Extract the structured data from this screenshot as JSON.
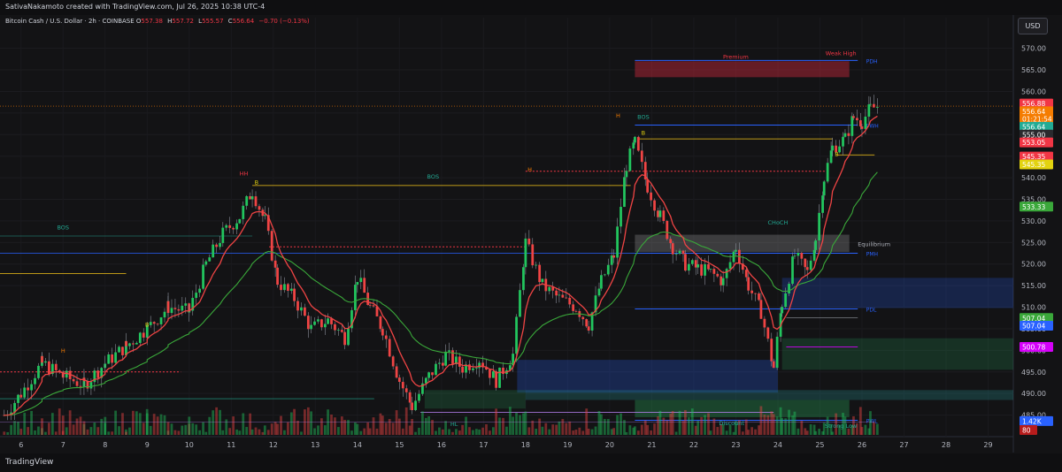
{
  "header": {
    "credit": "SativaNakamoto created with TradingView.com, Jul 26, 2025 10:38 UTC-4",
    "symbol": "Bitcoin Cash / U.S. Dollar · 2h · COINBASE",
    "open_label": "O",
    "open": "557.38",
    "high_label": "H",
    "high": "557.72",
    "low_label": "L",
    "low": "555.57",
    "close_label": "C",
    "close": "556.64",
    "change": "−0.70 (−0.13%)",
    "currency": "USD"
  },
  "footer": {
    "logo": "TradingView"
  },
  "colors": {
    "up": "#22c55e",
    "down": "#ef4444",
    "bg": "#131315",
    "ema_fast": "#ef4444",
    "ema_slow": "#3aa83a"
  },
  "chart_data": {
    "type": "candlestick",
    "ylim": [
      480,
      573
    ],
    "y_ticks": [
      "570.00",
      "565.00",
      "560.00",
      "555.00",
      "550.00",
      "545.00",
      "540.00",
      "535.00",
      "530.00",
      "525.00",
      "520.00",
      "515.00",
      "510.00",
      "505.00",
      "500.00",
      "495.00",
      "490.00",
      "485.00"
    ],
    "x_ticks": [
      "6",
      "7",
      "8",
      "9",
      "10",
      "11",
      "12",
      "13",
      "14",
      "15",
      "16",
      "17",
      "18",
      "19",
      "20",
      "21",
      "22",
      "23",
      "24",
      "25",
      "26",
      "27",
      "28",
      "29"
    ],
    "x_dom": [
      5.5,
      29.6
    ],
    "last_date": 26.4,
    "closes": [
      {
        "x": 5.6,
        "c": 485
      },
      {
        "x": 6.0,
        "c": 490
      },
      {
        "x": 6.5,
        "c": 497
      },
      {
        "x": 7.0,
        "c": 494
      },
      {
        "x": 7.5,
        "c": 492
      },
      {
        "x": 8.0,
        "c": 497
      },
      {
        "x": 8.5,
        "c": 501
      },
      {
        "x": 9.0,
        "c": 505
      },
      {
        "x": 9.5,
        "c": 510
      },
      {
        "x": 10.0,
        "c": 509
      },
      {
        "x": 10.4,
        "c": 520
      },
      {
        "x": 10.8,
        "c": 527
      },
      {
        "x": 11.2,
        "c": 531
      },
      {
        "x": 11.5,
        "c": 537
      },
      {
        "x": 11.8,
        "c": 530
      },
      {
        "x": 12.1,
        "c": 516
      },
      {
        "x": 12.5,
        "c": 512
      },
      {
        "x": 12.9,
        "c": 505
      },
      {
        "x": 13.3,
        "c": 507
      },
      {
        "x": 13.7,
        "c": 503
      },
      {
        "x": 14.0,
        "c": 517
      },
      {
        "x": 14.3,
        "c": 510
      },
      {
        "x": 14.6,
        "c": 505
      },
      {
        "x": 15.0,
        "c": 493
      },
      {
        "x": 15.3,
        "c": 487
      },
      {
        "x": 15.7,
        "c": 494
      },
      {
        "x": 16.1,
        "c": 499
      },
      {
        "x": 16.5,
        "c": 496
      },
      {
        "x": 16.9,
        "c": 498
      },
      {
        "x": 17.3,
        "c": 493
      },
      {
        "x": 17.7,
        "c": 499
      },
      {
        "x": 18.0,
        "c": 525
      },
      {
        "x": 18.4,
        "c": 515
      },
      {
        "x": 18.8,
        "c": 512
      },
      {
        "x": 19.2,
        "c": 510
      },
      {
        "x": 19.5,
        "c": 506
      },
      {
        "x": 19.8,
        "c": 516
      },
      {
        "x": 20.1,
        "c": 522
      },
      {
        "x": 20.4,
        "c": 543
      },
      {
        "x": 20.6,
        "c": 548
      },
      {
        "x": 20.9,
        "c": 538
      },
      {
        "x": 21.2,
        "c": 531
      },
      {
        "x": 21.5,
        "c": 524
      },
      {
        "x": 21.8,
        "c": 520
      },
      {
        "x": 22.1,
        "c": 519
      },
      {
        "x": 22.4,
        "c": 518
      },
      {
        "x": 22.7,
        "c": 516
      },
      {
        "x": 23.0,
        "c": 524
      },
      {
        "x": 23.3,
        "c": 515
      },
      {
        "x": 23.6,
        "c": 509
      },
      {
        "x": 23.9,
        "c": 496
      },
      {
        "x": 24.1,
        "c": 511
      },
      {
        "x": 24.4,
        "c": 522
      },
      {
        "x": 24.7,
        "c": 518
      },
      {
        "x": 24.9,
        "c": 526
      },
      {
        "x": 25.1,
        "c": 540
      },
      {
        "x": 25.3,
        "c": 547
      },
      {
        "x": 25.6,
        "c": 549
      },
      {
        "x": 25.8,
        "c": 554
      },
      {
        "x": 26.0,
        "c": 553
      },
      {
        "x": 26.2,
        "c": 556
      },
      {
        "x": 26.4,
        "c": 556.64
      }
    ],
    "price_labels": [
      {
        "text": "556.88",
        "value": 557.2,
        "color": "#f23645"
      },
      {
        "text": "556.64",
        "value": 555.4,
        "color": "#f57c00"
      },
      {
        "text": "01:21:54",
        "value": 553.6,
        "color": "#f57c00"
      },
      {
        "text": "556.64",
        "value": 551.8,
        "color": "#22ab94"
      },
      {
        "text": "555.00",
        "value": 550.0,
        "color": "#2a2a2e"
      },
      {
        "text": "553.05",
        "value": 548.2,
        "color": "#f23645"
      },
      {
        "text": "545.35",
        "value": 544.9,
        "color": "#f23645"
      },
      {
        "text": "545.35",
        "value": 543.1,
        "color": "#e3d30f"
      },
      {
        "text": "533.33",
        "value": 533.3,
        "color": "#3aa83a"
      },
      {
        "text": "507.04",
        "value": 507.5,
        "color": "#3aa83a"
      },
      {
        "text": "507.04",
        "value": 505.7,
        "color": "#2962ff"
      },
      {
        "text": "500.78",
        "value": 500.8,
        "color": "#d500f9"
      },
      {
        "text": "1.42K",
        "value": 483.6,
        "color": "#2962ff"
      }
    ],
    "zones": [
      {
        "label": "Premium",
        "y_top": 567,
        "y_bot": 563.3,
        "x_from": 20.6,
        "color": "rgba(200,40,60,0.45)"
      },
      {
        "label": "Equilibrium",
        "y_top": 526.8,
        "y_bot": 522.8,
        "x_from": 20.6,
        "color": "rgba(170,170,170,0.28)"
      },
      {
        "label": "Discount",
        "y_top": 488.5,
        "y_bot": 484.5,
        "x_from": 20.6,
        "color": "rgba(40,160,90,0.35)"
      }
    ],
    "levels": [
      {
        "label": "PDH",
        "value": 567.2,
        "color": "#2962ff"
      },
      {
        "label": "PWH",
        "value": 552.2,
        "color": "#2962ff"
      },
      {
        "label": "PMH",
        "value": 522.5,
        "color": "#2962ff"
      },
      {
        "label": "PDL",
        "value": 509.6,
        "color": "#2962ff"
      },
      {
        "label": "PWL",
        "value": 483.8,
        "color": "#2962ff"
      }
    ],
    "annotations": [
      {
        "text": "Weak High",
        "x": 25.5,
        "y": 568.4,
        "color": "#f23645"
      },
      {
        "text": "Strong Low",
        "x": 25.5,
        "y": 482.0,
        "color": "#22ab94"
      },
      {
        "text": "BOS",
        "x": 7.0,
        "y": 528,
        "color": "#22ab94"
      },
      {
        "text": "BOS",
        "x": 15.8,
        "y": 539.8,
        "color": "#22ab94"
      },
      {
        "text": "BOS",
        "x": 20.8,
        "y": 553.6,
        "color": "#22ab94"
      },
      {
        "text": "HL",
        "x": 16.3,
        "y": 482.5,
        "color": "#22ab94"
      },
      {
        "text": "HH",
        "x": 11.3,
        "y": 540.5,
        "color": "#f23645"
      },
      {
        "text": "CHoCH",
        "x": 24.0,
        "y": 529.2,
        "color": "#22ab94"
      },
      {
        "text": "B",
        "x": 11.6,
        "y": 538.5,
        "color": "#e3d30f"
      },
      {
        "text": "B",
        "x": 20.8,
        "y": 550,
        "color": "#e3d30f"
      },
      {
        "text": "B",
        "x": 25.4,
        "y": 545,
        "color": "#e3d30f"
      },
      {
        "text": "H",
        "x": 20.2,
        "y": 554,
        "color": "#f57c00"
      },
      {
        "text": "H",
        "x": 18.1,
        "y": 541.5,
        "color": "#f57c00"
      },
      {
        "text": "H",
        "x": 7.0,
        "y": 499.5,
        "color": "#f57c00"
      },
      {
        "text": "B",
        "x": 9.0,
        "y": 505.5,
        "color": "#e3d30f"
      }
    ],
    "volume_max": 1.42
  }
}
